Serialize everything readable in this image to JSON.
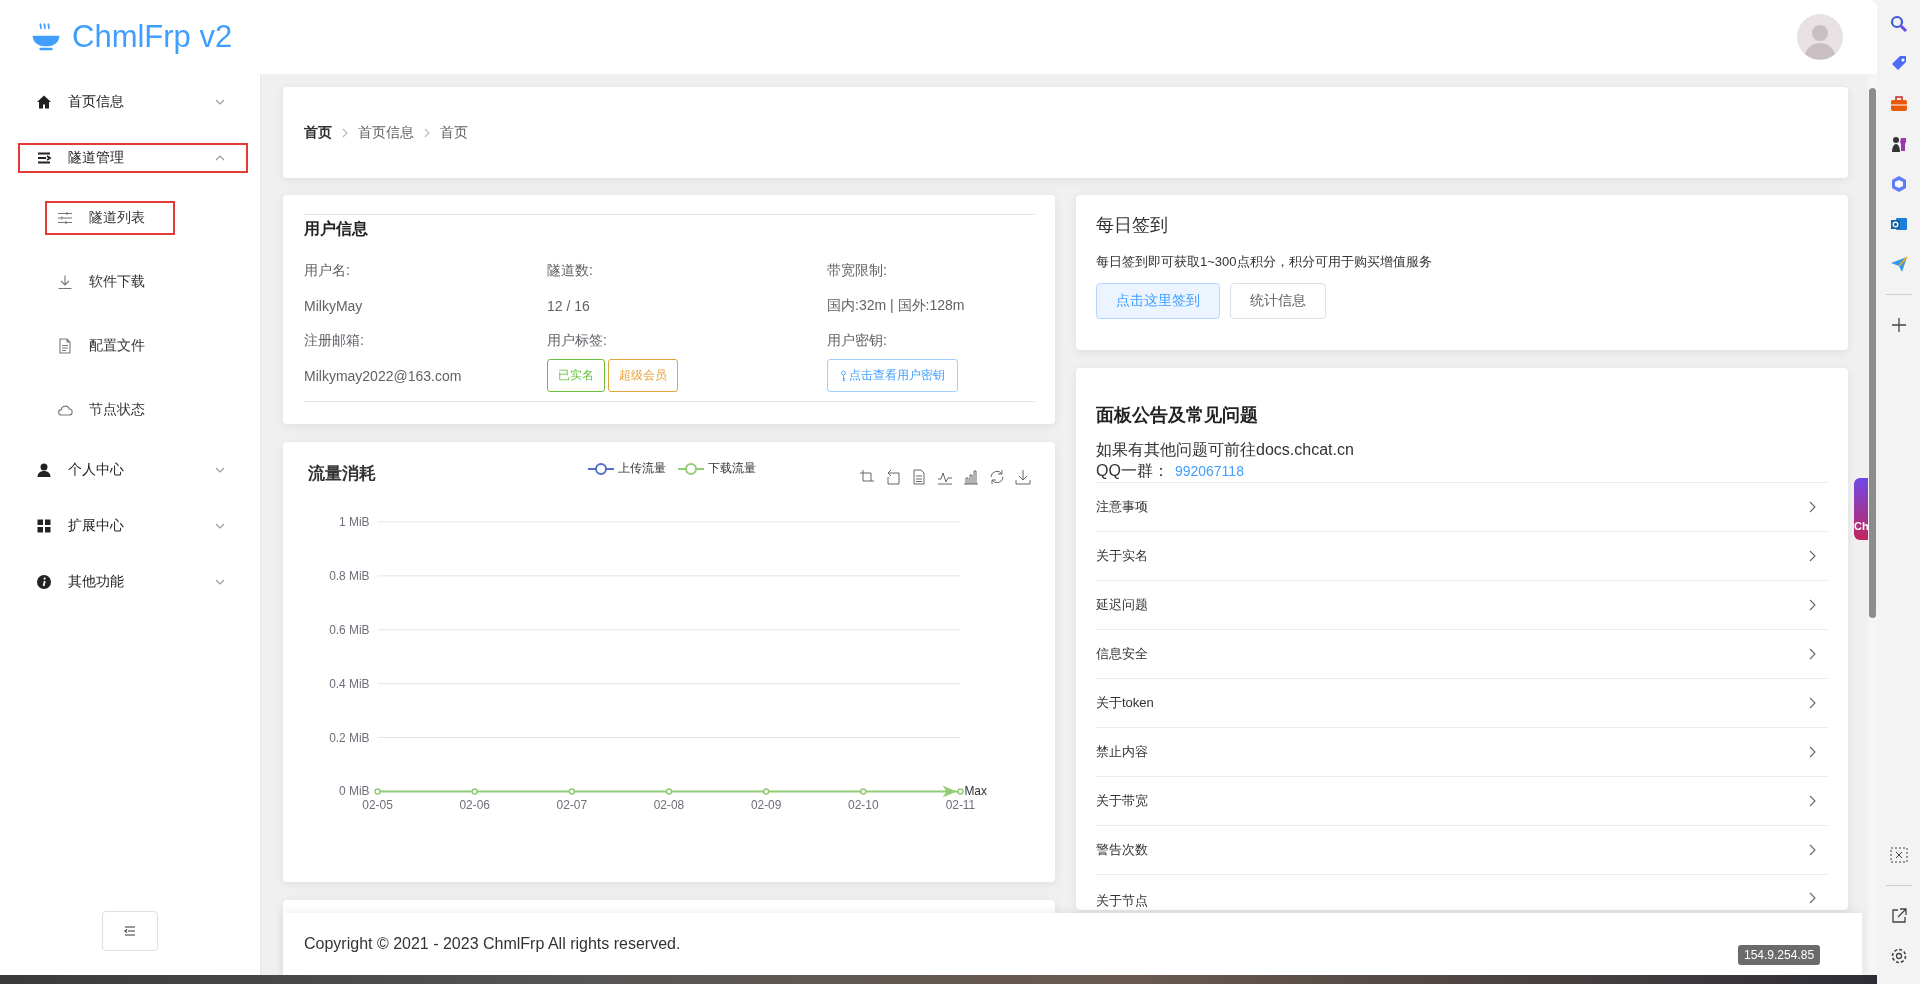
{
  "header": {
    "logo": "ChmlFrp v2"
  },
  "sidebar": {
    "items": [
      {
        "label": "首页信息",
        "expanded": false,
        "highlighted": false
      },
      {
        "label": "隧道管理",
        "expanded": true,
        "highlighted": true,
        "children": [
          {
            "label": "隧道列表",
            "highlighted": true
          },
          {
            "label": "软件下载",
            "highlighted": false
          },
          {
            "label": "配置文件",
            "highlighted": false
          },
          {
            "label": "节点状态",
            "highlighted": false
          }
        ]
      },
      {
        "label": "个人中心",
        "expanded": false,
        "highlighted": false
      },
      {
        "label": "扩展中心",
        "expanded": false,
        "highlighted": false
      },
      {
        "label": "其他功能",
        "expanded": false,
        "highlighted": false
      }
    ]
  },
  "breadcrumb": [
    "首页",
    "首页信息",
    "首页"
  ],
  "user_info": {
    "title": "用户信息",
    "fields": [
      {
        "kind": "text",
        "label": "用户名:",
        "value": "MilkyMay"
      },
      {
        "kind": "text",
        "label": "隧道数:",
        "value": "12 / 16"
      },
      {
        "kind": "text",
        "label": "带宽限制:",
        "value": "国内:32m | 国外:128m"
      },
      {
        "kind": "text",
        "label": "注册邮箱:",
        "value": "Milkymay2022@163.com"
      },
      {
        "kind": "tags",
        "label": "用户标签:",
        "tags": [
          {
            "label": "已实名",
            "color": "#67c23a"
          },
          {
            "label": "超级会员",
            "color": "#e6a23c"
          }
        ]
      },
      {
        "kind": "button",
        "label": "用户密钥:",
        "value": "点击查看用户密钥"
      }
    ]
  },
  "traffic": {
    "chart_data": {
      "type": "line",
      "title": "流量消耗",
      "categories": [
        "02-05",
        "02-06",
        "02-07",
        "02-08",
        "02-09",
        "02-10",
        "02-11"
      ],
      "series": [
        {
          "name": "上传流量",
          "color": "#5470c6",
          "marker": "circle",
          "values": [
            null,
            null,
            null,
            null,
            null,
            null,
            null
          ]
        },
        {
          "name": "下载流量",
          "color": "#91cc75",
          "marker": "circle",
          "values": [
            0,
            0,
            0,
            0,
            0,
            0,
            0
          ]
        }
      ],
      "grid": true,
      "ylim": [
        0,
        1
      ],
      "yticks": [
        {
          "value": 0,
          "label": "0 MiB"
        },
        {
          "value": 0.2,
          "label": "0.2 MiB"
        },
        {
          "value": 0.4,
          "label": "0.4 MiB"
        },
        {
          "value": 0.6,
          "label": "0.6 MiB"
        },
        {
          "value": 0.8,
          "label": "0.8 MiB"
        },
        {
          "value": 1,
          "label": "1 MiB"
        }
      ],
      "annotations": [
        {
          "text": "Max",
          "x": "02-11",
          "y": 0
        }
      ]
    }
  },
  "sign_in": {
    "title": "每日签到",
    "text": "每日签到即可获取1~300点积分，积分可用于购买增值服务",
    "buttons": [
      {
        "label": "点击这里签到",
        "kind": "primary"
      },
      {
        "label": "统计信息",
        "kind": "default"
      }
    ]
  },
  "faq": {
    "title": "面板公告及常见问题",
    "note": "如果有其他问题可前往docs.chcat.cn",
    "qq_label": "QQ一群：",
    "qq_number": "992067118",
    "items": [
      "注意事项",
      "关于实名",
      "延迟问题",
      "信息安全",
      "关于token",
      "禁止内容",
      "关于带宽",
      "警告次数",
      "关于节点"
    ]
  },
  "footer": {
    "text": "Copyright © 2021 - 2023 ChmlFrp All rights reserved."
  },
  "ip_badge": "154.9.254.85",
  "floating_widget": "Ch"
}
